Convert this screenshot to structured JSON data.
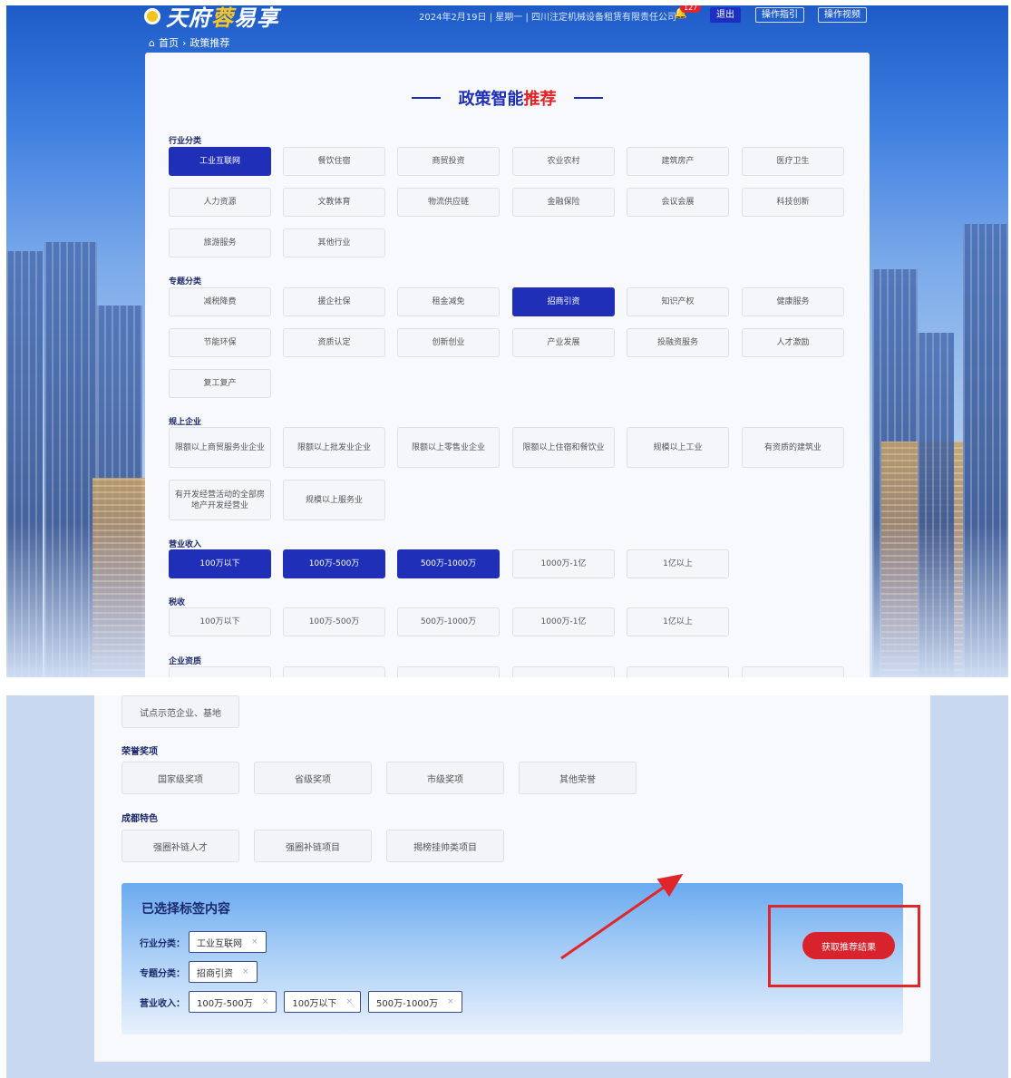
{
  "header": {
    "logo_main": "天府",
    "logo_highlight": "蓉",
    "logo_tail": "易享",
    "info": "2024年2月19日 | 星期一 | 四川注定机械设备租赁有限责任公司",
    "notification_count": "127",
    "logout": "退出",
    "guide": "操作指引",
    "video": "操作视频"
  },
  "breadcrumb": {
    "home": "首页",
    "current": "政策推荐"
  },
  "title": {
    "main": "政策智能",
    "accent": "推荐"
  },
  "sections": {
    "industry": {
      "label": "行业分类",
      "items": [
        "工业互联网",
        "餐饮住宿",
        "商贸投资",
        "农业农村",
        "建筑房产",
        "医疗卫生",
        "人力资源",
        "文教体育",
        "物流供应链",
        "金融保险",
        "会议会展",
        "科技创新",
        "旅游服务",
        "其他行业"
      ]
    },
    "topic": {
      "label": "专题分类",
      "items": [
        "减税降费",
        "援企社保",
        "租金减免",
        "招商引资",
        "知识产权",
        "健康服务",
        "节能环保",
        "资质认定",
        "创新创业",
        "产业发展",
        "投融资服务",
        "人才激励",
        "复工复产"
      ]
    },
    "scale": {
      "label": "规上企业",
      "items": [
        "限额以上商贸服务业企业",
        "限额以上批发业企业",
        "限额以上零售业企业",
        "限额以上住宿和餐饮业",
        "规模以上工业",
        "有资质的建筑业",
        "有开发经营活动的全部房地产开发经营业",
        "规模以上服务业"
      ]
    },
    "revenue": {
      "label": "营业收入",
      "items": [
        "100万以下",
        "100万-500万",
        "500万-1000万",
        "1000万-1亿",
        "1亿以上"
      ]
    },
    "tax": {
      "label": "税收",
      "items": [
        "100万以下",
        "100万-500万",
        "500万-1000万",
        "1000万-1亿",
        "1亿以上"
      ]
    },
    "qualification": {
      "label": "企业资质"
    }
  },
  "bottom": {
    "pilot": "试点示范企业、基地",
    "honor": {
      "label": "荣誉奖项",
      "items": [
        "国家级奖项",
        "省级奖项",
        "市级奖项",
        "其他荣誉"
      ]
    },
    "chengdu": {
      "label": "成都特色",
      "items": [
        "强圈补链人才",
        "强圈补链项目",
        "揭榜挂帅类项目"
      ]
    }
  },
  "selected": {
    "title": "已选择标签内容",
    "rows": [
      {
        "key": "行业分类：",
        "tags": [
          "工业互联网"
        ]
      },
      {
        "key": "专题分类：",
        "tags": [
          "招商引资"
        ]
      },
      {
        "key": "营业收入：",
        "tags": [
          "100万-500万",
          "100万以下",
          "500万-1000万"
        ]
      }
    ],
    "remove_symbol": "×",
    "action": "获取推荐结果"
  },
  "colors": {
    "primary": "#1f2fb8",
    "accent_red": "#e32222",
    "button_red": "#d8232c"
  }
}
